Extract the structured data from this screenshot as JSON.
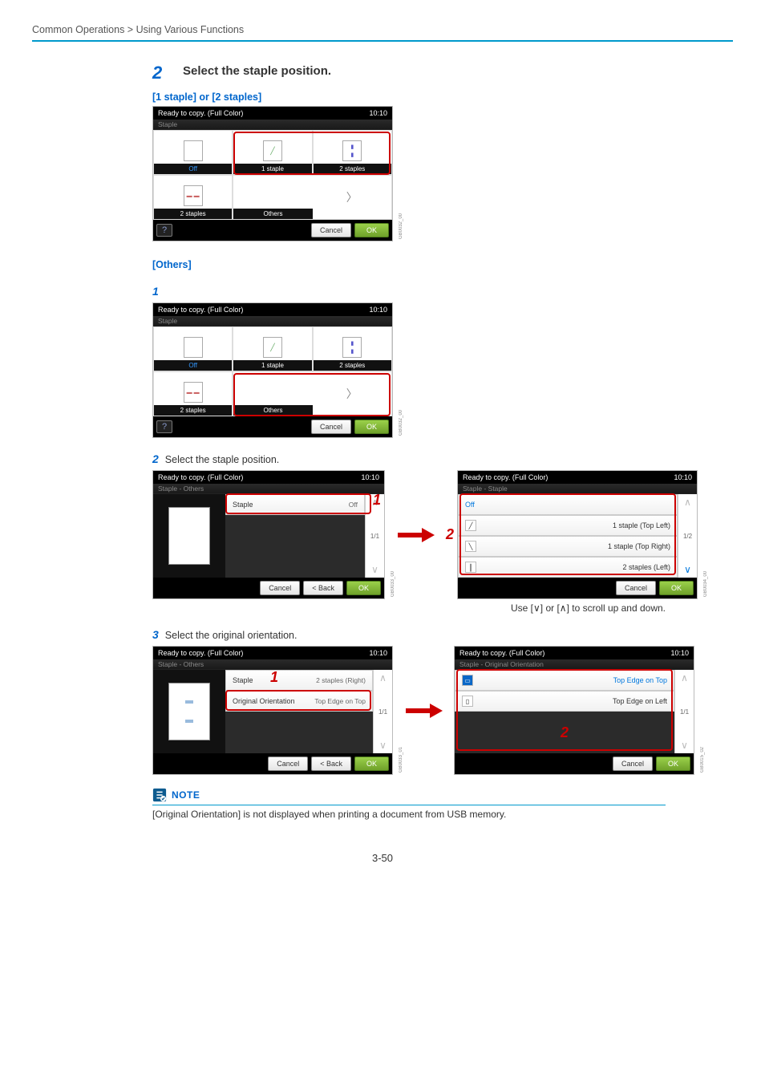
{
  "breadcrumb": "Common Operations > Using Various Functions",
  "page_number": "3-50",
  "step": {
    "number": "2",
    "title": "Select the staple position."
  },
  "section1": {
    "heading": "[1 staple] or [2 staples]"
  },
  "section2": {
    "heading": "[Others]",
    "sub1_num": "1",
    "sub2_num": "2",
    "sub2_text": "Select the staple position.",
    "sub3_num": "3",
    "sub3_text": "Select the original orientation."
  },
  "panel_common": {
    "status": "Ready to copy. (Full Color)",
    "time": "10:10",
    "cancel": "Cancel",
    "ok": "OK",
    "back": "< Back",
    "help": "?"
  },
  "panel_staple": {
    "crumb": "Staple",
    "off": "Off",
    "one": "1 staple",
    "two": "2 staples",
    "two_b": "2 staples",
    "others": "Others",
    "code": "GB0032_00"
  },
  "panel_others_main": {
    "crumb": "Staple - Others",
    "row_staple": "Staple",
    "row_val_off": "Off",
    "row_val_2r": "2 staples (Right)",
    "row_orient": "Original Orientation",
    "row_orient_val": "Top Edge on Top",
    "page_a": "1/1",
    "code_a": "GB0033_00",
    "code_b": "GB0033_01"
  },
  "panel_staple_list": {
    "crumb": "Staple - Staple",
    "items": [
      "Off",
      "1 staple (Top Left)",
      "1 staple (Top Right)",
      "2 staples (Left)"
    ],
    "page": "1/2",
    "code": "GB0034_00"
  },
  "panel_orient_list": {
    "crumb": "Staple - Original Orientation",
    "items": [
      "Top Edge on Top",
      "Top Edge on Left"
    ],
    "page": "1/1",
    "code": "GB0015_02"
  },
  "hint_arrows": {
    "down": "∨",
    "up": "∧"
  },
  "hint_text_parts": {
    "a": "Use [",
    "b": "] or [",
    "c": "] to scroll up and down."
  },
  "note": {
    "label": "NOTE",
    "body": "[Original Orientation] is not displayed when printing a document from USB memory."
  },
  "callouts": {
    "c1": "1",
    "c2": "2"
  }
}
